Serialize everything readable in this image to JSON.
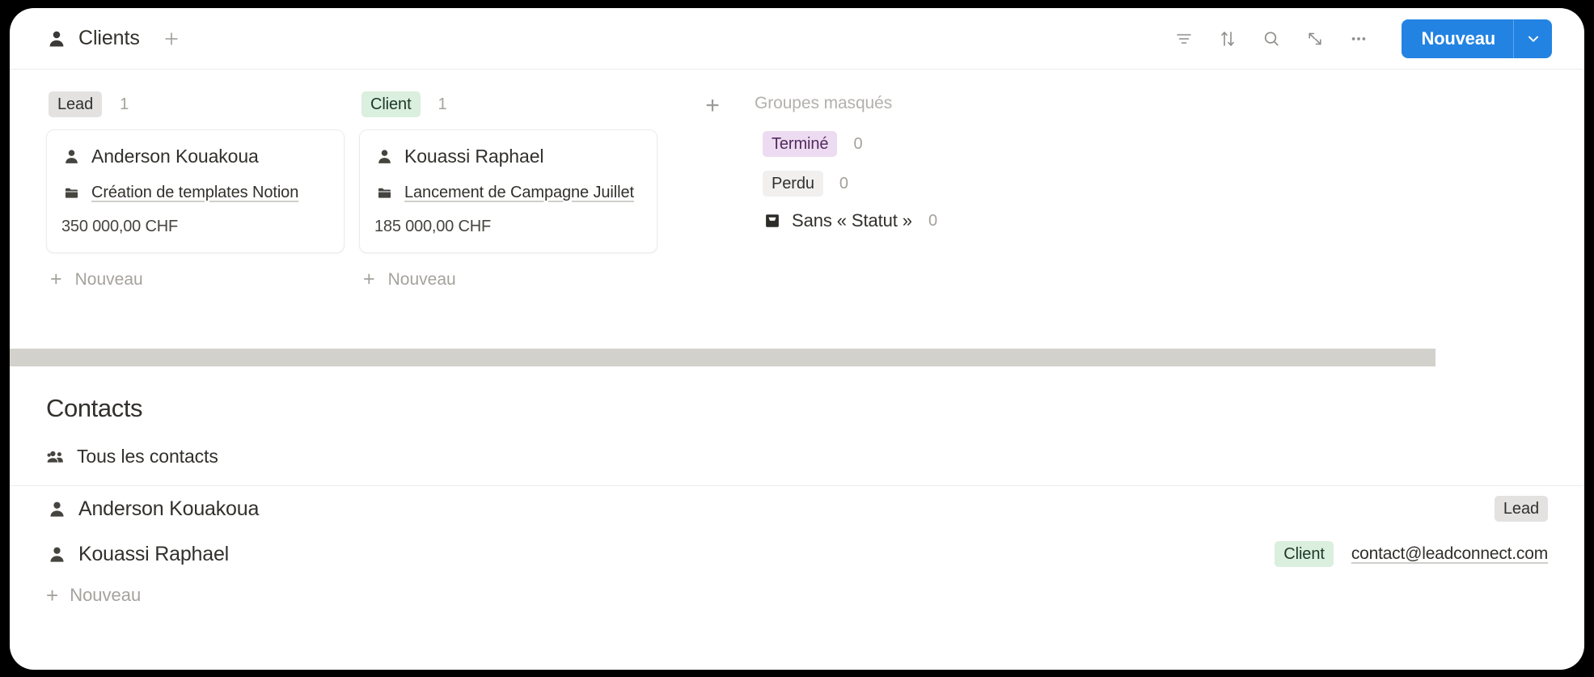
{
  "header": {
    "db_icon": "person-icon",
    "title": "Clients",
    "add_view_icon": "plus-icon",
    "tools": [
      {
        "name": "filter-icon",
        "label": "Filtrer"
      },
      {
        "name": "sort-icon",
        "label": "Trier"
      },
      {
        "name": "search-icon",
        "label": "Rechercher"
      },
      {
        "name": "expand-icon",
        "label": "Agrandir"
      },
      {
        "name": "more-icon",
        "label": "Plus"
      }
    ],
    "new_button": {
      "label": "Nouveau",
      "caret_icon": "chevron-down-icon",
      "color": "#2383e2"
    }
  },
  "board": {
    "columns": [
      {
        "status": "Lead",
        "status_style": "grey",
        "count": "1",
        "new_label": "Nouveau",
        "cards": [
          {
            "person_icon": "person-icon",
            "name": "Anderson Kouakoua",
            "project_icon": "folder-icon",
            "project": "Création de templates Notion",
            "amount": "350 000,00 CHF"
          }
        ]
      },
      {
        "status": "Client",
        "status_style": "green",
        "count": "1",
        "new_label": "Nouveau",
        "cards": [
          {
            "person_icon": "person-icon",
            "name": "Kouassi Raphael",
            "project_icon": "folder-icon",
            "project": "Lancement de Campagne Juillet",
            "amount": "185 000,00 CHF"
          }
        ]
      }
    ],
    "add_group_icon": "plus-icon",
    "hidden_groups": {
      "title": "Groupes masqués",
      "items": [
        {
          "label": "Terminé",
          "style": "purple",
          "count": "0",
          "icon": null
        },
        {
          "label": "Perdu",
          "style": "lightgrey",
          "count": "0",
          "icon": null
        },
        {
          "label": "Sans « Statut »",
          "style": "plain",
          "count": "0",
          "icon": "inbox-icon"
        }
      ]
    }
  },
  "scrollbar": {
    "name": "horizontal-scrollbar",
    "color": "#d3d1cc"
  },
  "contacts": {
    "title": "Contacts",
    "tab": {
      "icon": "people-group-icon",
      "label": "Tous les contacts"
    },
    "rows": [
      {
        "person_icon": "person-icon",
        "name": "Anderson Kouakoua",
        "badge": "Lead",
        "badge_style": "grey",
        "email": ""
      },
      {
        "person_icon": "person-icon",
        "name": "Kouassi Raphael",
        "badge": "Client",
        "badge_style": "green",
        "email": "contact@leadconnect.com"
      }
    ],
    "new_label": "Nouveau"
  },
  "colors": {
    "accent": "#2383e2",
    "chip_grey": "#e3e2e0",
    "chip_green": "#daefdd",
    "chip_purple": "#eddcf1",
    "text": "#32302c"
  }
}
